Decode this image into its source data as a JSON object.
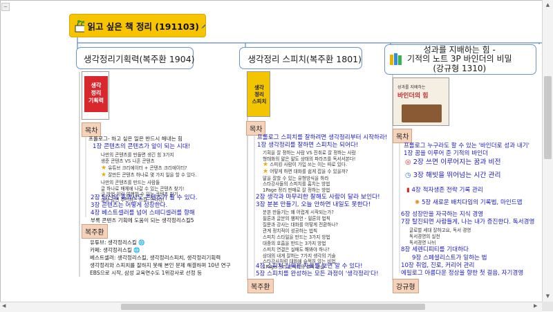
{
  "root": {
    "title": "읽고 싶은 책 정리 (191103)"
  },
  "books": [
    {
      "title": "생각정리기획력(복주환 1904)",
      "cover": {
        "line1": "생각",
        "line2": "정리",
        "line3": "기획력"
      },
      "toc_label": "목차",
      "toc": [
        "프롤로그- 하고 싶은 일은 반드시 해내는 힘",
        "1장 콘텐츠의 콘텐츠가 앞이 되는 시대!",
        "나만의 콘텐츠를 만들면 생긴 힘 3가지",
        "생준 콘텐츠 VS 나혼 콘텐츠",
        "유튜브 크리에이터 + 콘텐츠 크리에이터?",
        "잘만든 콘텐츠 하나로 몇 가지 일을 할 수 있다.",
        "나만의 콘텐츠를 만드는 사람들",
        "글 하나로 매체에 나갈 수 있는 콘텐츠 찾기!",
        "글 방법 이랑 여행할 수 있는 콘텐츠 찾기",
        "실상 감면 추천하는 스킬, 안다라!",
        "2장 당신의 흑역사도 콘텐츠가 될 수 있다.",
        "3장 콘텐츠는 어떻게 성장한다.",
        "4장 베스트셀러를 넘어 스테디셀러를 향해",
        "부록 콘텐츠 기획에 도움이 되는 생각정리스킬5"
      ],
      "author_label": "복주환",
      "author": [
        "유튜브: 생각정리스킬",
        "카페: 생각정리스킬",
        "베스트셀러: 생각정리스킬, 생각정리스피치, 생각정리기획력",
        "생각정리와 스피치를 잘하지 못해 본인 문제 해결하며 10년 연구",
        "EBS으로 시작, 삼성 교육연수도 1위강사로 선정 등"
      ]
    },
    {
      "title": "생각정리 스피치(복주환 1801)",
      "cover": {
        "line1": "생각",
        "line2": "정리",
        "line3": "스피치"
      },
      "toc_label": "목차",
      "toc": [
        "프롤로그 스피치를 잘하려면 생각정리부터 시작하라!",
        "1장 생각정리를 잘하면 스피치는 되어다!",
        "기획을 잘 정하는 사람 VS 진취로 잘 정하는 사람",
        "형태화의 말은 말도 상태의 파라즈를 독서서본다!",
        "스피킹 사람이 가입 쓰는 이는 따로 있다.",
        "어떻게 하면 대화를 쉽게 잡을 수 있을까?",
        "말을 잘할 수 있는 유형방식을 하라",
        "스타강사들의 스피치를 훔치는 방법",
        "1Page 정리 판매로 잘 정하는 방법",
        "2장 생각과 마무리한 잘해도 사람이 달라 보인다!",
        "3장 분본 만들기, 오늘 안하면 내일도 못한다!",
        "분본 만들기는 왜 어렵게 시작되는가?",
        "필론과 글분의 챔피언 - 필론의 법칙",
        "질문과 강사는 대화를 어떻게 전환하나?",
        "관계 정치적이 성공하는 법칙",
        "스피치 스타일을 만드는 3가지 방법",
        "대중의 호흡을 만드는 3가지 방법",
        "스피치 연결은 실패도 해봐야 하나?",
        "상대의 내게 잘하는 7가지 생각의 기술",
        "스타강사처럼 대화에 슬쩍히 않는 비법",
        "1Page 정리 스피치의 코치 연습",
        "4장 스피치 실력은 차료를 보면 알 수 있다!",
        "5장 스피치를 완성하는 모든 과정이 '생각정리'다!"
      ],
      "author_label": "복주환"
    },
    {
      "title_line1": "성과를 지배하는 힘 -",
      "title_line2": "기적의 노트 3P 바인더의 비밀",
      "title_line3": "(강규형 1310)",
      "cover": {
        "line1": "성과를 지배하는",
        "line2": "바인더의 힘"
      },
      "toc_label": "목차",
      "toc": [
        "프롤로그 누구라도 할 수 있는 '바인더로 성과 내기'",
        "1장 꿈을 이루어 준 기적의 바인더",
        "2장 쓰면 이루어지는 꿈과 비전",
        "3장 해빗을 뛰어넘는 시간 관리",
        "4장 적자생존 전략 기록 관리",
        "5장 새로운 배치다임의 기록법, 마인드맵",
        "6장 성장만을 자극하는 지식 경영",
        "7장 탈진되면 사람들게, 나는 내가 증진한다. 독서경영",
        "글로벌 세대 잘하고요, 독서 경영",
        "독서경영의 실천",
        "독서경영 나뉘",
        "8장 세렌디피티를 기대하다",
        "9장 스페셜리스트가 일하는 법",
        "10장 취업, 진로, 커리어 관리",
        "에필로그 아름다운 정상을 향한 첫 걸음, 자기경영"
      ],
      "author_label": "강규형"
    }
  ]
}
